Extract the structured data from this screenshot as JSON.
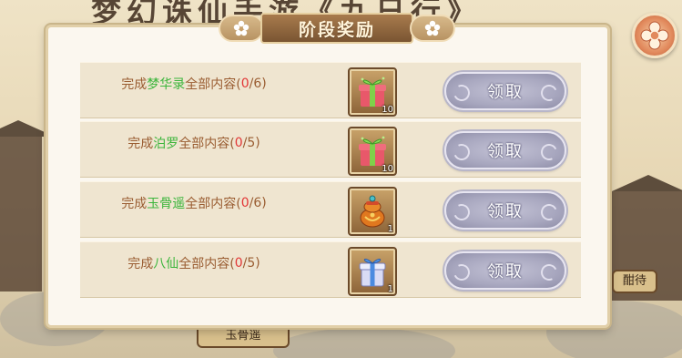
{
  "background": {
    "title_text": "梦幻诛仙手游《九日行》",
    "side_tag_text": "酣待",
    "bottom_tag_text": "玉骨遥"
  },
  "dialog": {
    "title": "阶段奖励",
    "rows": [
      {
        "prefix": "完成",
        "highlight": "梦华录",
        "middle": "全部内容(",
        "progress": "0",
        "suffix": "/6)",
        "reward_icon": "green-gift-box-icon",
        "reward_count": "10",
        "button_label": "领取"
      },
      {
        "prefix": "完成",
        "highlight": "泊罗",
        "middle": "全部内容(",
        "progress": "0",
        "suffix": "/5)",
        "reward_icon": "green-gift-box-icon",
        "reward_count": "10",
        "button_label": "领取"
      },
      {
        "prefix": "完成",
        "highlight": "玉骨遥",
        "middle": "全部内容(",
        "progress": "0",
        "suffix": "/6)",
        "reward_icon": "treasure-bag-icon",
        "reward_count": "1",
        "button_label": "领取"
      },
      {
        "prefix": "完成",
        "highlight": "八仙",
        "middle": "全部内容(",
        "progress": "0",
        "suffix": "/5)",
        "reward_icon": "blue-gift-box-icon",
        "reward_count": "1",
        "button_label": "领取"
      }
    ]
  },
  "colors": {
    "highlight": "#3bb53b",
    "progress": "#e23636",
    "text": "#9a5d32",
    "button": "#a8a7bf"
  }
}
